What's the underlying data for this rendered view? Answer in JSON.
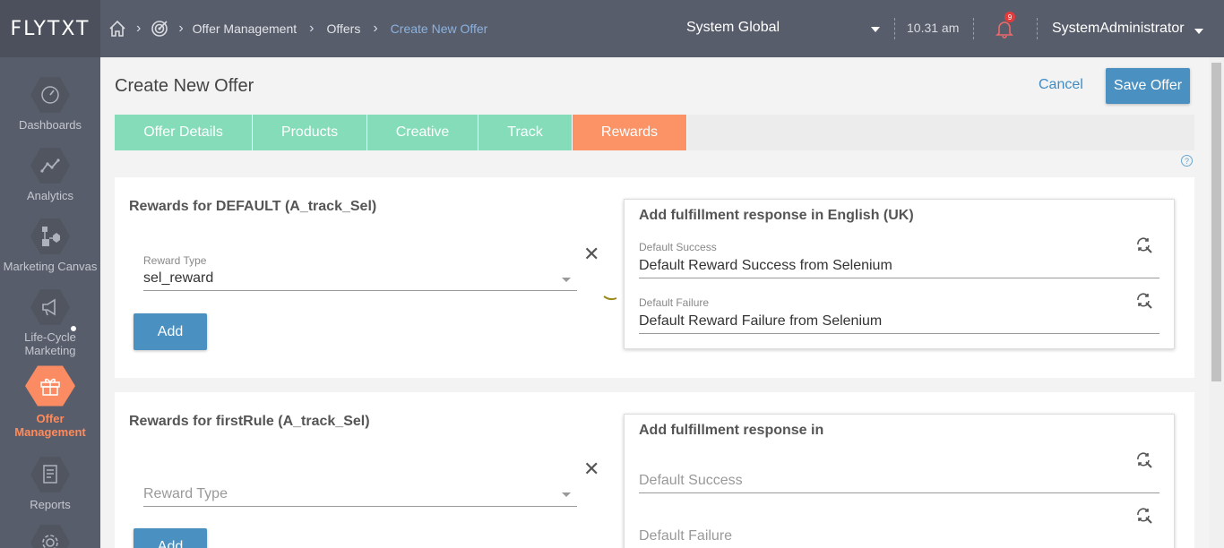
{
  "header": {
    "logo": "FLYTXT",
    "breadcrumbs": [
      "Offer Management",
      "Offers",
      "Create New Offer"
    ],
    "org": "System Global",
    "time": "10.31 am",
    "notification_count": "9",
    "user": "SystemAdministrator"
  },
  "sidebar": {
    "items": [
      {
        "label": "Dashboards",
        "icon": "gauge-icon"
      },
      {
        "label": "Analytics",
        "icon": "line-chart-icon"
      },
      {
        "label": "Marketing Canvas",
        "icon": "flow-icon"
      },
      {
        "label": "Life-Cycle",
        "label2": "Marketing",
        "icon": "megaphone-icon"
      },
      {
        "label": "Offer",
        "label2": "Management",
        "icon": "gift-icon"
      },
      {
        "label": "Reports",
        "icon": "report-icon"
      }
    ]
  },
  "page": {
    "title": "Create New Offer",
    "cancel": "Cancel",
    "save": "Save Offer"
  },
  "tabs": [
    "Offer Details",
    "Products",
    "Creative",
    "Track",
    "Rewards"
  ],
  "active_tab": "Rewards",
  "cards": [
    {
      "title": "Rewards for DEFAULT (A_track_Sel)",
      "reward_type_label": "Reward Type",
      "reward_type_value": "sel_reward",
      "add_label": "Add",
      "fulfillment_title": "Add fulfillment response in English (UK)",
      "success_label": "Default Success",
      "success_value": "Default Reward Success from Selenium",
      "failure_label": "Default Failure",
      "failure_value": "Default Reward Failure from Selenium"
    },
    {
      "title": "Rewards for firstRule (A_track_Sel)",
      "reward_type_placeholder": "Reward Type",
      "add_label": "Add",
      "fulfillment_title": "Add fulfillment response in",
      "success_placeholder": "Default Success",
      "failure_placeholder": "Default Failure"
    }
  ],
  "colors": {
    "header_bg": "#585d6b",
    "tab_green": "#84dcb9",
    "tab_active": "#fb9366",
    "primary_button": "#4a90c0",
    "active_nav": "#fb8b62"
  }
}
